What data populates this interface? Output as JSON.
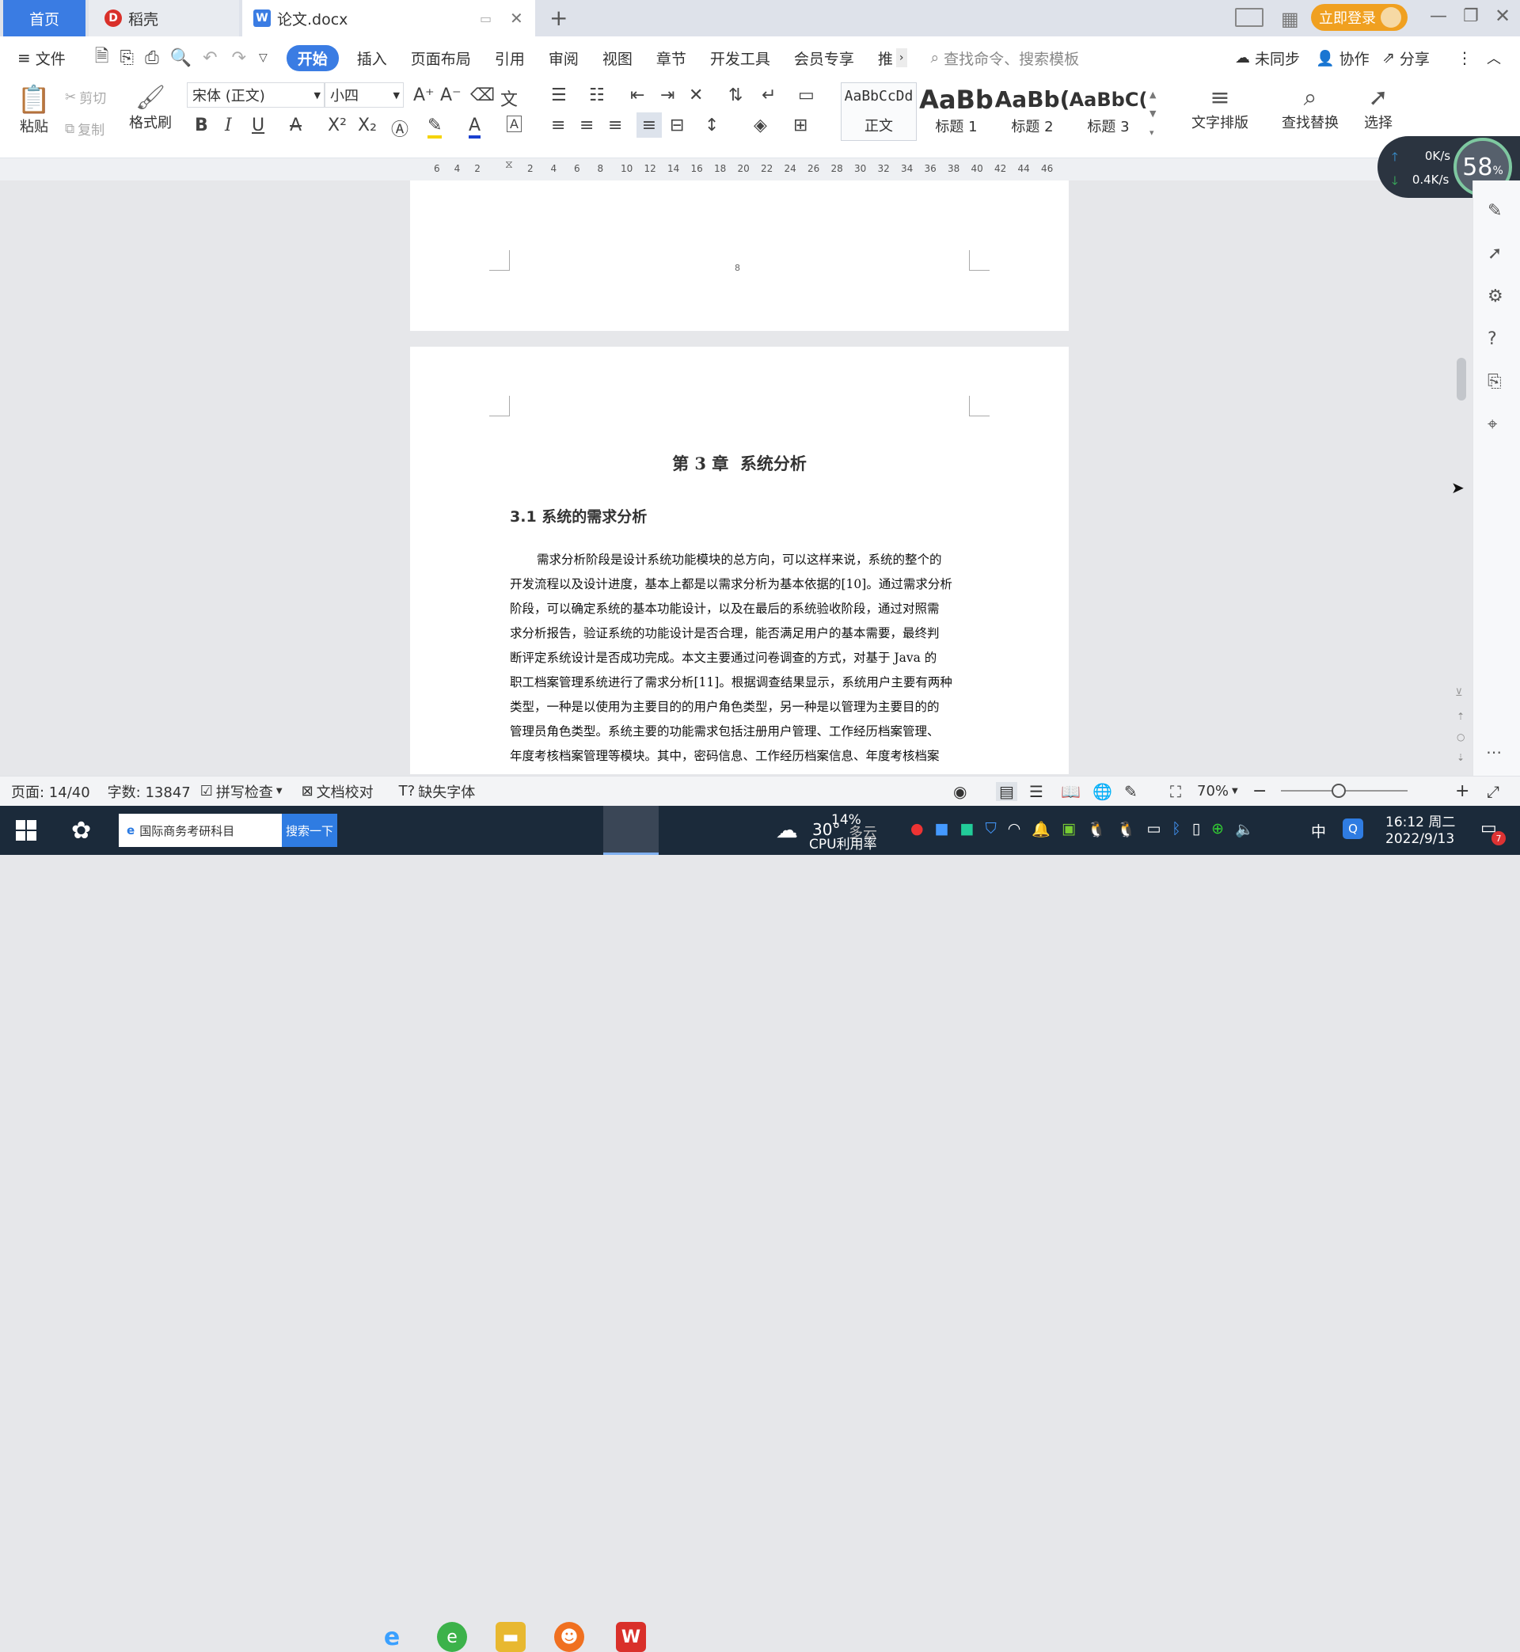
{
  "tabs": {
    "home": "首页",
    "daoke": "稻壳",
    "doc": "论文.docx"
  },
  "title_bar": {
    "login": "立即登录"
  },
  "ribbon_tabs": {
    "file": "文件",
    "items": [
      "开始",
      "插入",
      "页面布局",
      "引用",
      "审阅",
      "视图",
      "章节",
      "开发工具",
      "会员专享",
      "推"
    ],
    "search_placeholder": "查找命令、搜索模板",
    "unsynced": "未同步",
    "collab": "协作",
    "share": "分享"
  },
  "ribbon": {
    "paste": "粘贴",
    "cut": "剪切",
    "copy": "复制",
    "format_painter": "格式刷",
    "font_name": "宋体 (正文)",
    "font_size": "小四",
    "styles": [
      {
        "preview": "AaBbCcDd",
        "name": "正文"
      },
      {
        "preview": "AaBb",
        "name": "标题 1"
      },
      {
        "preview": "AaBb(",
        "name": "标题 2"
      },
      {
        "preview": "AaBbC(",
        "name": "标题 3"
      }
    ],
    "text_layout": "文字排版",
    "find_replace": "查找替换",
    "select": "选择"
  },
  "ruler": {
    "left_marks": [
      "6",
      "4",
      "2"
    ],
    "right_marks": [
      "2",
      "4",
      "6",
      "8",
      "10",
      "12",
      "14",
      "16",
      "18",
      "20",
      "22",
      "24",
      "26",
      "28",
      "30",
      "32",
      "34",
      "36",
      "38",
      "40",
      "42",
      "44",
      "46"
    ]
  },
  "net_widget": {
    "up": "0K/s",
    "down": "0.4K/s",
    "cpu": "58",
    "cpu_unit": "%"
  },
  "document": {
    "page_number": "8",
    "chapter_title": "第 3 章  系统分析",
    "section_title": "3.1 系统的需求分析",
    "lines": [
      "需求分析阶段是设计系统功能模块的总方向，可以这样来说，系统的整个的",
      "开发流程以及设计进度，基本上都是以需求分析为基本依据的[10]。通过需求分析",
      "阶段，可以确定系统的基本功能设计，以及在最后的系统验收阶段，通过对照需",
      "求分析报告，验证系统的功能设计是否合理，能否满足用户的基本需要，最终判",
      "断评定系统设计是否成功完成。本文主要通过问卷调查的方式，对基于 Java 的",
      "职工档案管理系统进行了需求分析[11]。根据调查结果显示，系统用户主要有两种",
      "类型，一种是以使用为主要目的的用户角色类型，另一种是以管理为主要目的的",
      "管理员角色类型。系统主要的功能需求包括注册用户管理、工作经历档案管理、",
      "年度考核档案管理等模块。其中，密码信息、工作经历档案信息、年度考核档案"
    ]
  },
  "status": {
    "page": "页面: 14/40",
    "words": "字数: 13847",
    "spell": "拼写检查",
    "proof": "文档校对",
    "missing_font": "缺失字体",
    "zoom": "70%"
  },
  "taskbar": {
    "search_text": "国际商务考研科目",
    "search_button": "搜索一下",
    "weather_temp": "30°",
    "weather_desc": "多云",
    "cpu_pct": "14%",
    "cpu_label": "CPU利用率",
    "ime": "中",
    "time": "16:12 周二",
    "date": "2022/9/13",
    "notif_count": "7"
  },
  "colors": {
    "accent": "#3a7ce3",
    "login": "#f0a020",
    "wps_red": "#d9302a"
  }
}
